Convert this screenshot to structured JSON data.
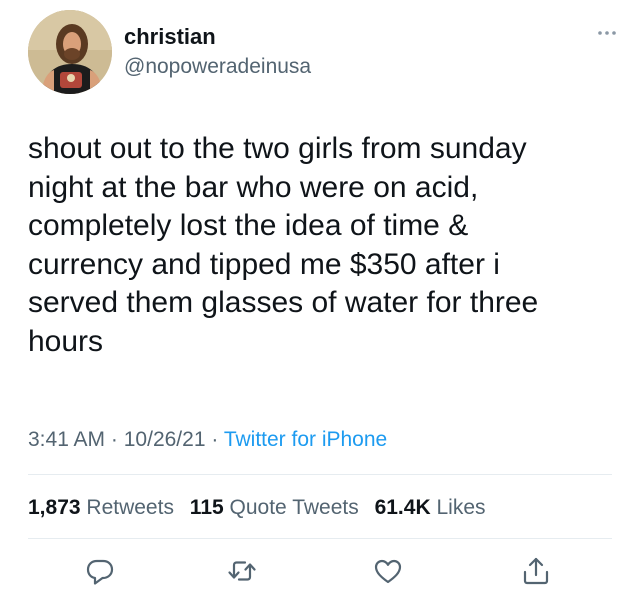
{
  "author": {
    "display_name": "christian",
    "handle": "@nopoweradeinusa"
  },
  "tweet": {
    "text": "shout out to the two girls from sunday\nnight at the bar who were on acid,\ncompletely lost the idea of time &\ncurrency and tipped me $350 after i\nserved them glasses of water for three\nhours",
    "time": "3:41 AM",
    "date": "10/26/21",
    "separator": "·",
    "source": "Twitter for iPhone"
  },
  "stats": {
    "retweets_count": "1,873",
    "retweets_label": "Retweets",
    "quotes_count": "115",
    "quotes_label": "Quote Tweets",
    "likes_count": "61.4K",
    "likes_label": "Likes"
  },
  "icons": {
    "more": "more-dots-icon",
    "reply": "reply-icon",
    "retweet": "retweet-icon",
    "like": "heart-icon",
    "share": "share-icon"
  },
  "colors": {
    "text_primary": "#0f1419",
    "text_secondary": "#536471",
    "link": "#1d9bf0",
    "divider": "#e6ecf0"
  }
}
